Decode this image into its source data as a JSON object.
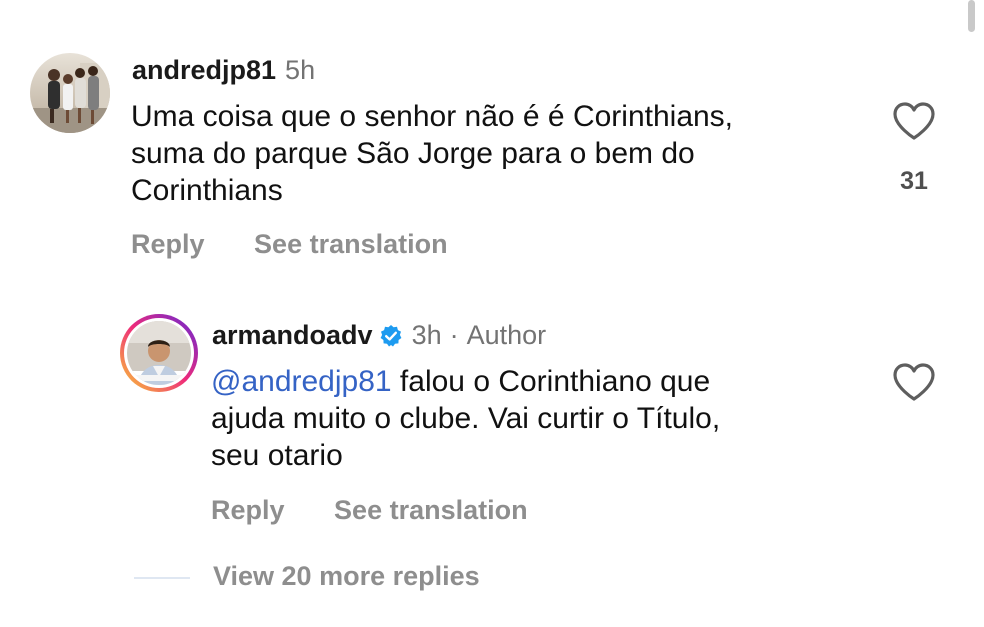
{
  "comment1": {
    "username": "andredjp81",
    "time": "5h",
    "text_lines": [
      "Uma coisa que o senhor não é é Corinthians,",
      "suma do parque São Jorge para o bem do",
      "Corinthians"
    ],
    "likes": "31",
    "reply_label": "Reply",
    "translate_label": "See translation"
  },
  "comment2": {
    "username": "armandoadv",
    "time": "3h",
    "separator": "·",
    "author_label": "Author",
    "mention": "@andredjp81",
    "text_first_rest": " falou o Corinthiano que",
    "text_lines": [
      "ajuda muito o clube. Vai curtir o Título,",
      "seu otario"
    ],
    "reply_label": "Reply",
    "translate_label": "See translation"
  },
  "more_replies_label": "View 20 more replies",
  "colors": {
    "mention": "#3563c5",
    "verified_badge": "#1d9bf0",
    "muted": "#8e8e8e",
    "story_ring_start": "#f9ce34",
    "story_ring_mid": "#ee2a7b",
    "story_ring_end": "#6228d7"
  },
  "icons": {
    "like": "heart-outline-icon",
    "verified": "verified-badge-icon"
  }
}
